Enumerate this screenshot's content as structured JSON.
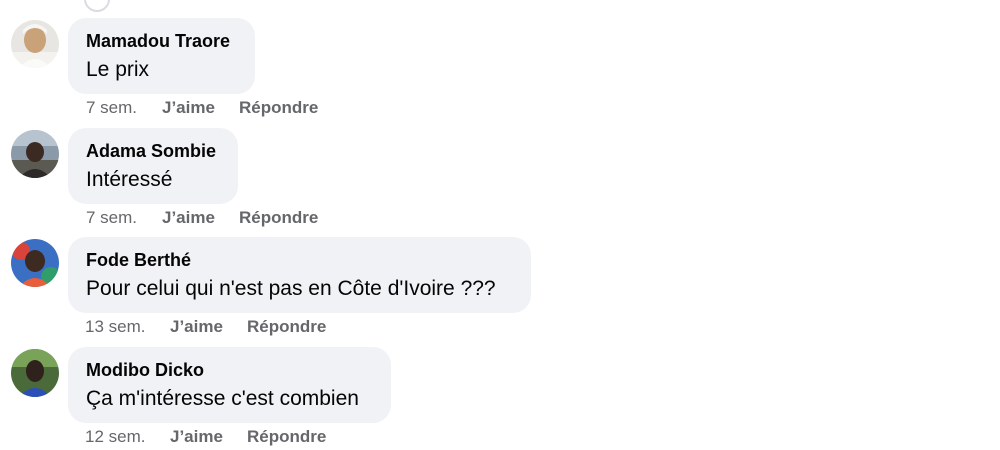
{
  "comments": [
    {
      "author": "Mamadou Traore",
      "text": "Le prix",
      "time": "7 sem.",
      "like_label": "J’aime",
      "reply_label": "Répondre"
    },
    {
      "author": "Adama Sombie",
      "text": "Intéressé",
      "time": "7 sem.",
      "like_label": "J’aime",
      "reply_label": "Répondre"
    },
    {
      "author": "Fode Berthé",
      "text": "Pour celui qui n'est pas en Côte d'Ivoire ???",
      "time": "13 sem.",
      "like_label": "J’aime",
      "reply_label": "Répondre"
    },
    {
      "author": "Modibo Dicko",
      "text": "Ça m'intéresse c'est combien",
      "time": "12 sem.",
      "like_label": "J’aime",
      "reply_label": "Répondre"
    }
  ],
  "icons": {
    "avatar": "profile-photo"
  },
  "colors": {
    "bubble": "#f0f2f5",
    "text": "#050505",
    "meta": "#65676b"
  }
}
